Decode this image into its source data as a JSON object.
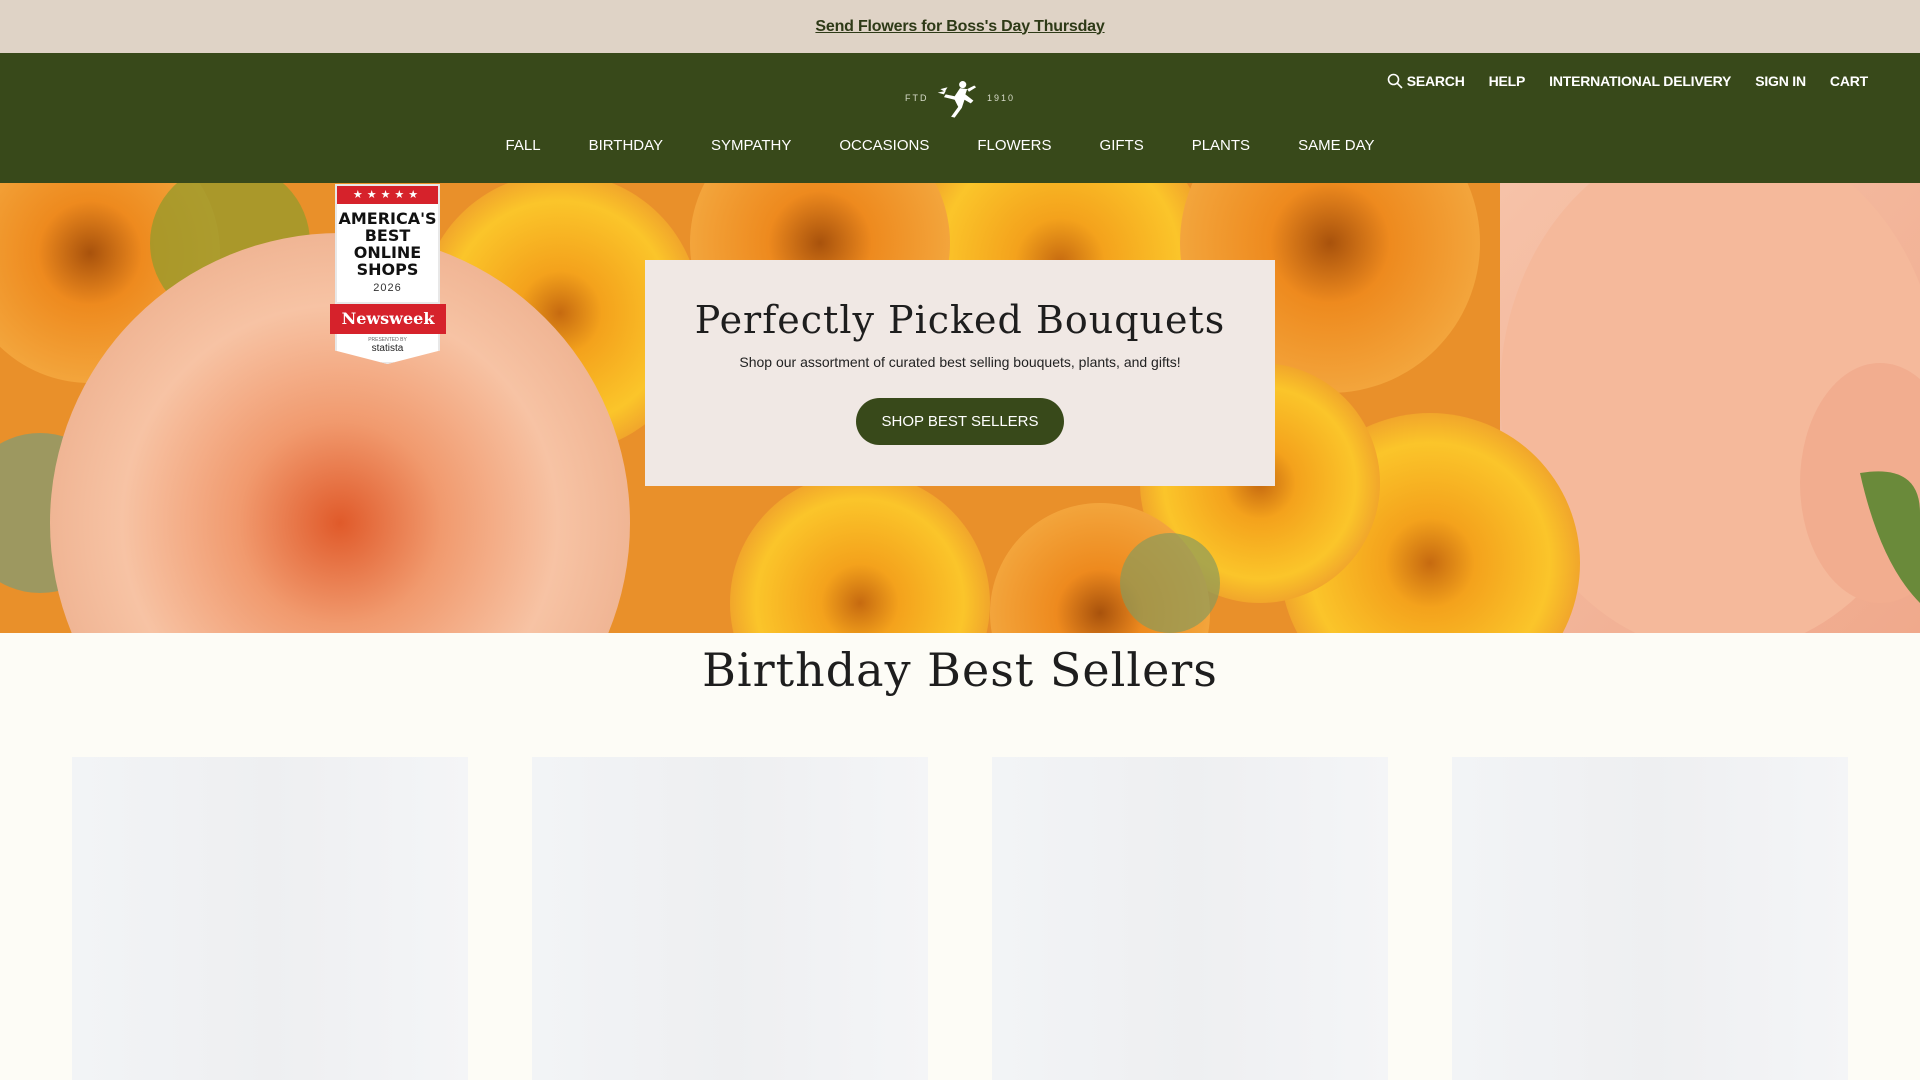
{
  "promo": {
    "link_text": "Send Flowers for Boss's Day Thursday"
  },
  "header": {
    "logo": {
      "left_text": "FTD",
      "right_text": "1910",
      "icon": "mercury-man-logo"
    },
    "utility": {
      "search": "SEARCH",
      "help": "HELP",
      "international": "INTERNATIONAL DELIVERY",
      "sign_in": "SIGN IN",
      "cart": "CART"
    },
    "nav": [
      {
        "label": "FALL"
      },
      {
        "label": "BIRTHDAY"
      },
      {
        "label": "SYMPATHY"
      },
      {
        "label": "OCCASIONS"
      },
      {
        "label": "FLOWERS"
      },
      {
        "label": "GIFTS"
      },
      {
        "label": "PLANTS"
      },
      {
        "label": "SAME DAY"
      }
    ]
  },
  "hero": {
    "title": "Perfectly Picked Bouquets",
    "subtitle": "Shop our assortment of curated best selling bouquets, plants, and gifts!",
    "button": "SHOP BEST SELLERS"
  },
  "badge": {
    "stars": "★★★★★",
    "headline_lines": [
      "AMERICA'S",
      "BEST",
      "ONLINE",
      "SHOPS"
    ],
    "year": "2026",
    "brand": "Newsweek",
    "presented": "PRESENTED BY",
    "partner": "statista"
  },
  "section": {
    "title": "Birthday Best Sellers",
    "cards": [
      {},
      {},
      {},
      {}
    ]
  },
  "colors": {
    "brand_green": "#38491a",
    "promo_bg": "#dfd3c6",
    "page_bg": "#fdfcf6",
    "card_bg": "#f0e8e4"
  }
}
